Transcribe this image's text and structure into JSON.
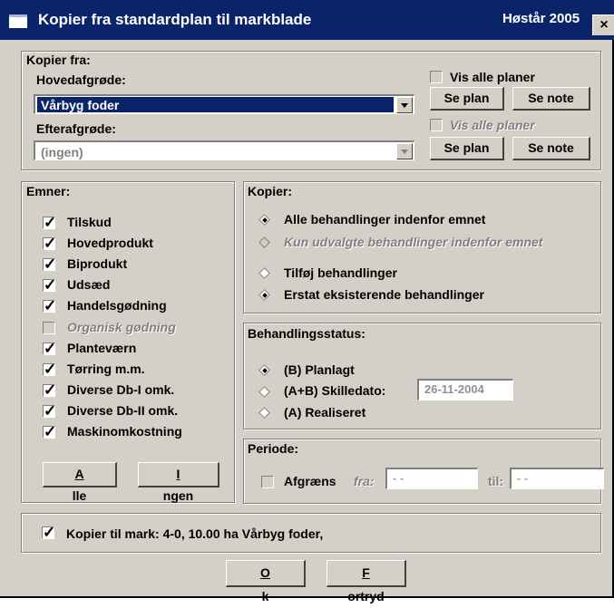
{
  "window": {
    "title": "Kopier fra standardplan til markblade",
    "season": "Høstår 2005",
    "close": "×"
  },
  "kopier_fra": {
    "label": "Kopier fra:",
    "hovedafgroede": {
      "label": "Hovedafgrøde:",
      "value": "Vårbyg foder",
      "show_all_label": "Vis alle planer",
      "se_plan": "Se plan",
      "se_note": "Se note"
    },
    "efterafgroede": {
      "label": "Efterafgrøde:",
      "value": "(ingen)",
      "show_all_label": "Vis alle planer",
      "se_plan": "Se plan",
      "se_note": "Se note"
    }
  },
  "emner": {
    "label": "Emner:",
    "items": [
      {
        "label": "Tilskud",
        "checked": true
      },
      {
        "label": "Hovedprodukt",
        "checked": true
      },
      {
        "label": "Biprodukt",
        "checked": true
      },
      {
        "label": "Udsæd",
        "checked": true
      },
      {
        "label": "Handelsgødning",
        "checked": true
      },
      {
        "label": "Organisk gødning",
        "checked": false
      },
      {
        "label": "Planteværn",
        "checked": true
      },
      {
        "label": "Tørring m.m.",
        "checked": true
      },
      {
        "label": "Diverse Db-I omk.",
        "checked": true
      },
      {
        "label": "Diverse Db-II omk.",
        "checked": true
      },
      {
        "label": "Maskinomkostning",
        "checked": true
      }
    ],
    "alle_first": "A",
    "alle_rest": "lle",
    "ingen_first": "I",
    "ingen_rest": "ngen"
  },
  "kopier": {
    "label": "Kopier:",
    "option_all": "Alle behandlinger indenfor emnet",
    "option_selected": "Kun udvalgte behandlinger indenfor emnet",
    "option_add": "Tilføj behandlinger",
    "option_replace": "Erstat eksisterende behandlinger"
  },
  "status": {
    "label": "Behandlingsstatus:",
    "planned": "(B) Planlagt",
    "cutoff": "(A+B) Skilledato:",
    "cutoff_date": "26-11-2004",
    "realized": "(A) Realiseret"
  },
  "periode": {
    "label": "Periode:",
    "limit": "Afgræns",
    "from": "fra:",
    "from_value": "-  -",
    "to": "til:",
    "to_value": "-  -"
  },
  "footer": {
    "copy_to": "Kopier til mark: 4-0,  10.00 ha Vårbyg foder,",
    "ok_first": "O",
    "ok_rest": "k",
    "cancel_first": "F",
    "cancel_rest": "ortryd"
  }
}
